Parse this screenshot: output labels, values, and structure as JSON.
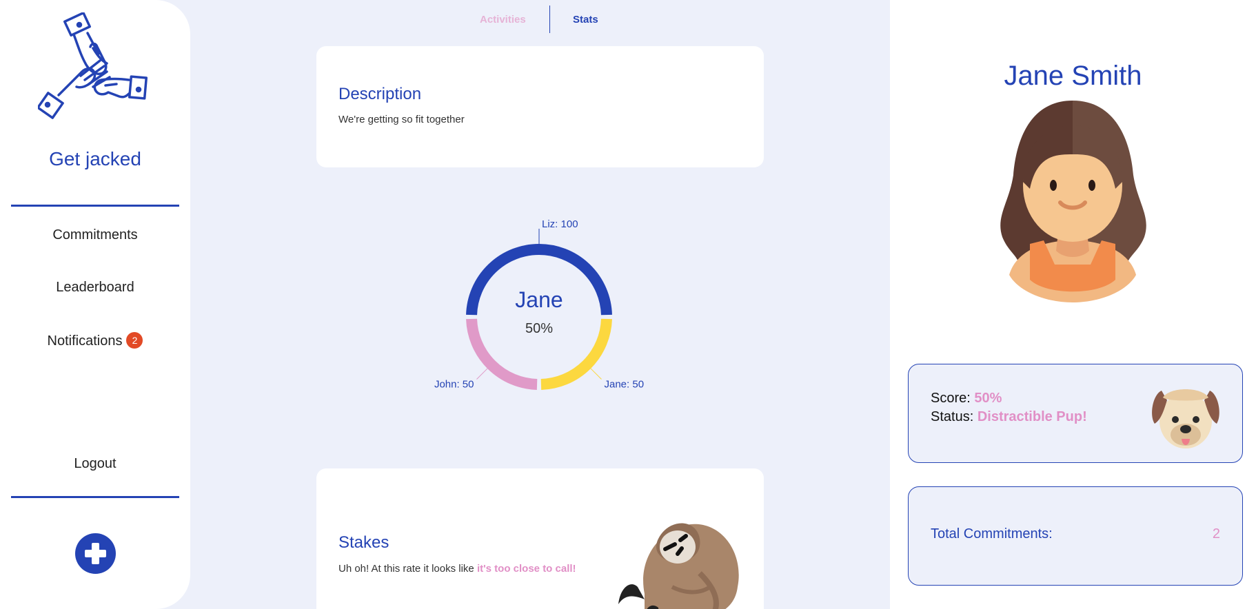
{
  "sidebar": {
    "group_title": "Get jacked",
    "nav": {
      "commitments": "Commitments",
      "leaderboard": "Leaderboard",
      "notifications": "Notifications",
      "notifications_count": "2",
      "logout": "Logout"
    }
  },
  "tabs": {
    "activities": "Activities",
    "stats": "Stats"
  },
  "description": {
    "title": "Description",
    "text": "We're getting so fit together"
  },
  "chart_data": {
    "type": "pie",
    "center_title": "Jane",
    "center_value": "50%",
    "slices": [
      {
        "label": "Liz: 100",
        "name": "Liz",
        "value": 100,
        "color": "#2443b4"
      },
      {
        "label": "Jane: 50",
        "name": "Jane",
        "value": 50,
        "color": "#fcd83f"
      },
      {
        "label": "John: 50",
        "name": "John",
        "value": 50,
        "color": "#e09ac8"
      }
    ]
  },
  "stakes": {
    "title": "Stakes",
    "text": "Uh oh! At this rate it looks like ",
    "highlight": "it's too close to call!"
  },
  "profile": {
    "name": "Jane Smith",
    "score_label": "Score:",
    "score_value": "50%",
    "status_label": "Status:",
    "status_value": "Distractible Pup!",
    "total_label": "Total Commitments:",
    "total_value": "2"
  },
  "colors": {
    "primary": "#2443b4",
    "accent_pink": "#e18fc6",
    "badge": "#e24a26",
    "background": "#edf0fa"
  }
}
